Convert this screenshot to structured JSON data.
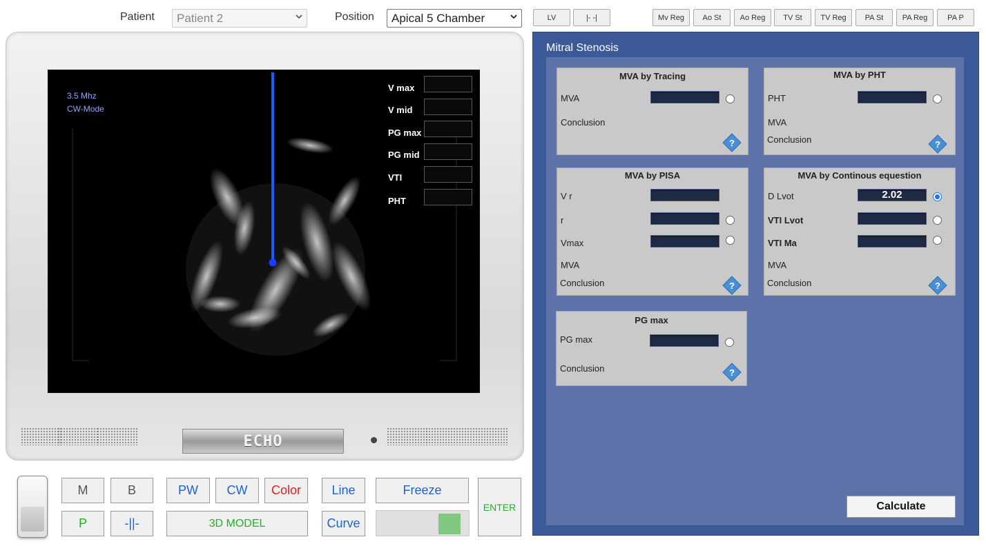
{
  "top_bar": {
    "patient_label": "Patient",
    "patient_value": "Patient 2",
    "position_label": "Position",
    "position_value": "Apical 5 Chamber",
    "view_buttons": [
      "LV",
      "|- -|"
    ],
    "condition_buttons": [
      "Mv Reg",
      "Ao St",
      "Ao Reg",
      "TV St",
      "TV Reg",
      "PA St",
      "PA Reg",
      "PA P"
    ]
  },
  "screen": {
    "frequency": "3.5 Mhz",
    "mode": "CW-Mode",
    "measurements": [
      "V max",
      "V mid",
      "PG max",
      "PG mid",
      "VTI",
      "PHT"
    ]
  },
  "monitor": {
    "brand": "ECHO"
  },
  "controls": {
    "m": "M",
    "b": "B",
    "p": "P",
    "split": "-||-",
    "pw": "PW",
    "cw": "CW",
    "color": "Color",
    "model3d": "3D MODEL",
    "line": "Line",
    "curve": "Curve",
    "freeze": "Freeze",
    "enter": "ENTER"
  },
  "panel": {
    "title": "Mitral Stenosis",
    "calculate": "Calculate",
    "cards": {
      "tracing": {
        "title": "MVA by Tracing",
        "mva": "MVA",
        "conclusion": "Conclusion"
      },
      "pht": {
        "title": "MVA by PHT",
        "pht": "PHT",
        "mva": "MVA",
        "conclusion": "Conclusion"
      },
      "pisa": {
        "title": "MVA by PISA",
        "vr": "V r",
        "r": "r",
        "vmax": "Vmax",
        "mva": "MVA",
        "conclusion": "Conclusion"
      },
      "continuous": {
        "title": "MVA by Continous equestion",
        "dlvot": "D Lvot",
        "dlvot_value": "2.02",
        "vtilvot": "VTI Lvot",
        "vtima": "VTI Ma",
        "mva": "MVA",
        "conclusion": "Conclusion"
      },
      "pg": {
        "title": "PG max",
        "pgmax": "PG max",
        "conclusion": "Conclusion"
      }
    }
  },
  "colors": {
    "panel_bg": "#3c5a9a",
    "inner_bg": "#5d72a8",
    "field_bg": "#1f2a45",
    "cursor_line": "#1a5cff",
    "accent_green": "#20b020"
  }
}
